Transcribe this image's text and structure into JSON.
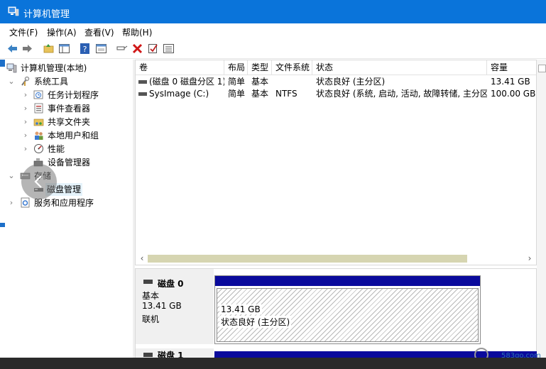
{
  "window": {
    "title": "计算机管理"
  },
  "menu": [
    "文件(F)",
    "操作(A)",
    "查看(V)",
    "帮助(H)"
  ],
  "toolbar_icons": [
    "back-arrow-icon",
    "forward-arrow-icon",
    "up-folder-icon",
    "show-hide-tree-icon",
    "help-icon",
    "properties-icon",
    "connect-icon",
    "delete-icon",
    "check-icon",
    "list-icon"
  ],
  "tree": {
    "root": "计算机管理(本地)",
    "system_tools": "系统工具",
    "task_scheduler": "任务计划程序",
    "event_viewer": "事件查看器",
    "shared_folders": "共享文件夹",
    "local_users": "本地用户和组",
    "performance": "性能",
    "device_manager": "设备管理器",
    "storage": "存储",
    "disk_management": "磁盘管理",
    "services_apps": "服务和应用程序"
  },
  "volumes": {
    "columns": [
      "卷",
      "布局",
      "类型",
      "文件系统",
      "状态",
      "容量"
    ],
    "rows": [
      [
        "(磁盘 0 磁盘分区 1)",
        "简单",
        "基本",
        "",
        "状态良好 (主分区)",
        "13.41 GB"
      ],
      [
        "SysImage (C:)",
        "简单",
        "基本",
        "NTFS",
        "状态良好 (系统, 启动, 活动, 故障转储, 主分区)",
        "100.00 GB"
      ]
    ]
  },
  "disk0": {
    "name": "磁盘 0",
    "type": "基本",
    "size": "13.41 GB",
    "status": "联机",
    "partition_size": "13.41 GB",
    "partition_status": "状态良好 (主分区)"
  },
  "disk1": {
    "name": "磁盘 1"
  },
  "watermark": "583go.com",
  "colors": {
    "titlebar": "#0a74da",
    "partition_bar": "#0a0a9c"
  }
}
